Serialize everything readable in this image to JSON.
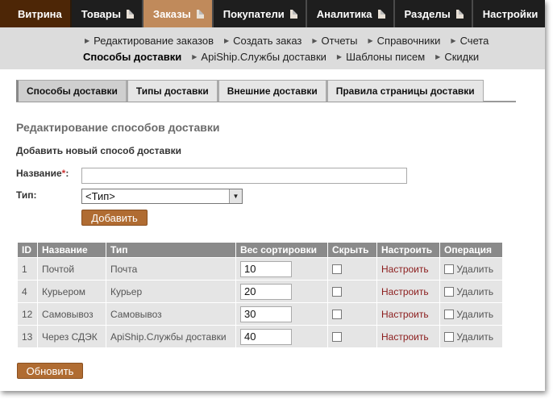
{
  "topnav": [
    {
      "label": "Витрина",
      "icon": false
    },
    {
      "label": "Товары",
      "icon": true
    },
    {
      "label": "Заказы",
      "icon": true,
      "active": true
    },
    {
      "label": "Покупатели",
      "icon": true
    },
    {
      "label": "Аналитика",
      "icon": true
    },
    {
      "label": "Разделы",
      "icon": true
    },
    {
      "label": "Настройки",
      "icon": false
    }
  ],
  "subnav": {
    "row1": [
      "Редактирование заказов",
      "Создать заказ",
      "Отчеты",
      "Справочники",
      "Счета"
    ],
    "row2_active": "Способы доставки",
    "row2": [
      "ApiShip.Службы доставки",
      "Шаблоны писем",
      "Скидки"
    ]
  },
  "tabs": [
    "Способы доставки",
    "Типы доставки",
    "Внешние доставки",
    "Правила страницы доставки"
  ],
  "form": {
    "title": "Редактирование способов доставки",
    "subtitle": "Добавить новый способ доставки",
    "name_label": "Название",
    "required_mark": "*",
    "name_colon": ":",
    "type_label": "Тип:",
    "type_value": "<Тип>",
    "add_button": "Добавить"
  },
  "table": {
    "headers": [
      "ID",
      "Название",
      "Тип",
      "Вес сортировки",
      "Скрыть",
      "Настроить",
      "Операция"
    ],
    "rows": [
      {
        "id": "1",
        "name": "Почтой",
        "type": "Почта",
        "weight": "10",
        "configure": "Настроить",
        "delete": "Удалить"
      },
      {
        "id": "4",
        "name": "Курьером",
        "type": "Курьер",
        "weight": "20",
        "configure": "Настроить",
        "delete": "Удалить"
      },
      {
        "id": "12",
        "name": "Самовывоз",
        "type": "Самовывоз",
        "weight": "30",
        "configure": "Настроить",
        "delete": "Удалить"
      },
      {
        "id": "13",
        "name": "Через СДЭК",
        "type": "ApiShip.Службы доставки",
        "weight": "40",
        "configure": "Настроить",
        "delete": "Удалить"
      }
    ]
  },
  "update_button": "Обновить"
}
